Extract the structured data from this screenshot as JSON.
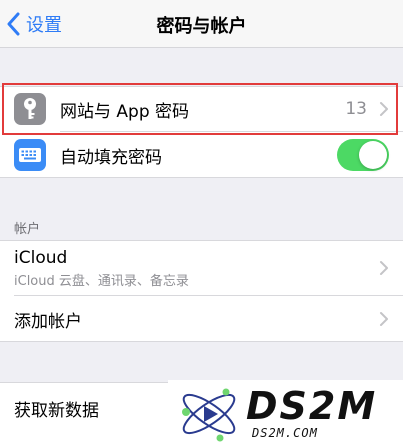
{
  "navbar": {
    "back_label": "设置",
    "title": "密码与帐户"
  },
  "passwords_group": {
    "website_passwords": {
      "label": "网站与 App 密码",
      "count": "13"
    },
    "autofill": {
      "label": "自动填充密码",
      "enabled": true
    }
  },
  "accounts_section": {
    "header": "帐户",
    "icloud": {
      "title": "iCloud",
      "subtitle": "iCloud 云盘、通讯录、备忘录"
    },
    "add_account": "添加帐户"
  },
  "fetch_group": {
    "fetch_new_data": "获取新数据"
  },
  "watermark": {
    "logo": "DS2M",
    "url": "DS2M.COM"
  },
  "colors": {
    "accent": "#2f7cf6",
    "toggle_on": "#4cd964",
    "highlight": "#e23b3b",
    "background": "#efeff4"
  }
}
